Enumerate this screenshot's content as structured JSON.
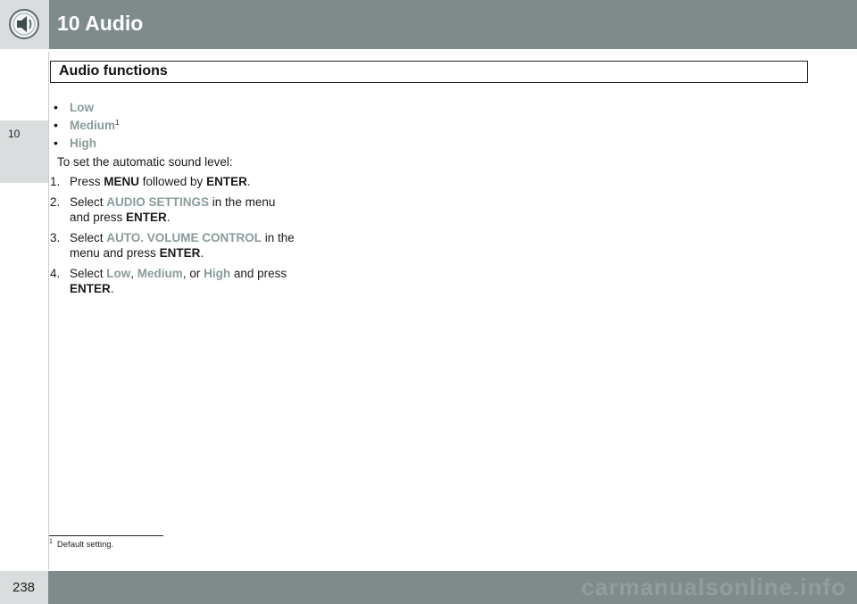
{
  "header": {
    "chapter_title": "10 Audio",
    "icon": "speaker-icon"
  },
  "section": {
    "title": "Audio functions"
  },
  "sidebar": {
    "tab_label": "10"
  },
  "levels": {
    "items": [
      "Low",
      "Medium",
      "High"
    ],
    "medium_footnote_marker": "1"
  },
  "instructions": {
    "intro": "To set the automatic sound level:",
    "steps": [
      {
        "number": "1.",
        "t1": "Press ",
        "b1": "MENU",
        "t2": " followed by ",
        "b2": "ENTER",
        "t3": "."
      },
      {
        "number": "2.",
        "t1": "Select ",
        "h1": "AUDIO SETTINGS",
        "t2": " in the menu and press ",
        "b1": "ENTER",
        "t3": "."
      },
      {
        "number": "3.",
        "t1": "Select ",
        "h1": "AUTO. VOLUME CONTROL",
        "t2": " in the menu and press ",
        "b1": "ENTER",
        "t3": "."
      },
      {
        "number": "4.",
        "t1": "Select ",
        "h1": "Low",
        "s1": ", ",
        "h2": "Medium",
        "s2": ", or ",
        "h3": "High",
        "t2": " and press ",
        "b1": "ENTER",
        "t3": "."
      }
    ]
  },
  "footnote": {
    "marker": "1",
    "text": "Default setting."
  },
  "footer": {
    "page_number": "238",
    "watermark": "carmanualsonline.info"
  },
  "colors": {
    "band": "#7f8b8b",
    "tab": "#d9dddd",
    "highlight": "#8a9a9a"
  }
}
